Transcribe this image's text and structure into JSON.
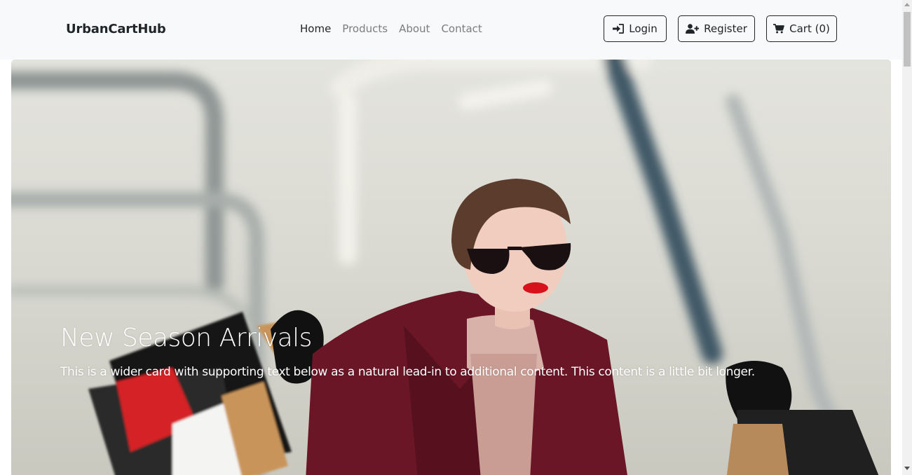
{
  "brand": {
    "name": "UrbanCartHub"
  },
  "nav": {
    "links": [
      {
        "label": "Home"
      },
      {
        "label": "Products"
      },
      {
        "label": "About"
      },
      {
        "label": "Contact"
      }
    ]
  },
  "actions": {
    "login_label": "Login",
    "register_label": "Register",
    "cart_label": "Cart (0)"
  },
  "hero": {
    "title": "New Season Arrivals",
    "text": "This is a wider card with supporting text below as a natural lead-in to additional content. This content is a little bit longer."
  },
  "colors": {
    "navbar_bg": "#f8f9fa",
    "text_dark": "#212529",
    "nav_muted": "#7a7d80",
    "coat": "#6b1626"
  }
}
